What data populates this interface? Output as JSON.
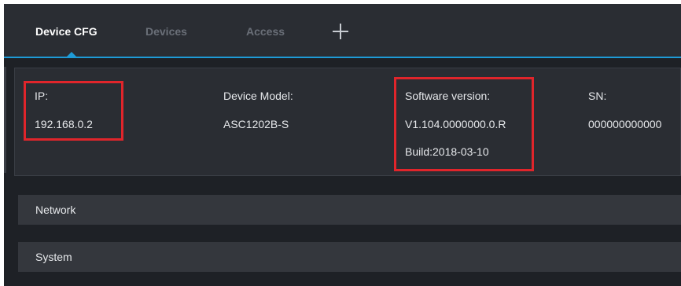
{
  "tabs": [
    {
      "label": "Device CFG",
      "active": true
    },
    {
      "label": "Devices",
      "active": false
    },
    {
      "label": "Access",
      "active": false
    }
  ],
  "add_tab_icon": "plus-icon",
  "info": {
    "ip": {
      "label": "IP:",
      "value": "192.168.0.2"
    },
    "model": {
      "label": "Device Model:",
      "value": "ASC1202B-S"
    },
    "software": {
      "label": "Software version:",
      "value": "V1.104.0000000.0.R",
      "build": "Build:2018-03-10"
    },
    "sn": {
      "label": "SN:",
      "value": "000000000000"
    }
  },
  "sections": [
    {
      "label": "Network"
    },
    {
      "label": "System"
    }
  ],
  "colors": {
    "background": "#1e2126",
    "panel": "#2a2d33",
    "accent": "#1e9bd7",
    "highlight": "#e0252b"
  }
}
